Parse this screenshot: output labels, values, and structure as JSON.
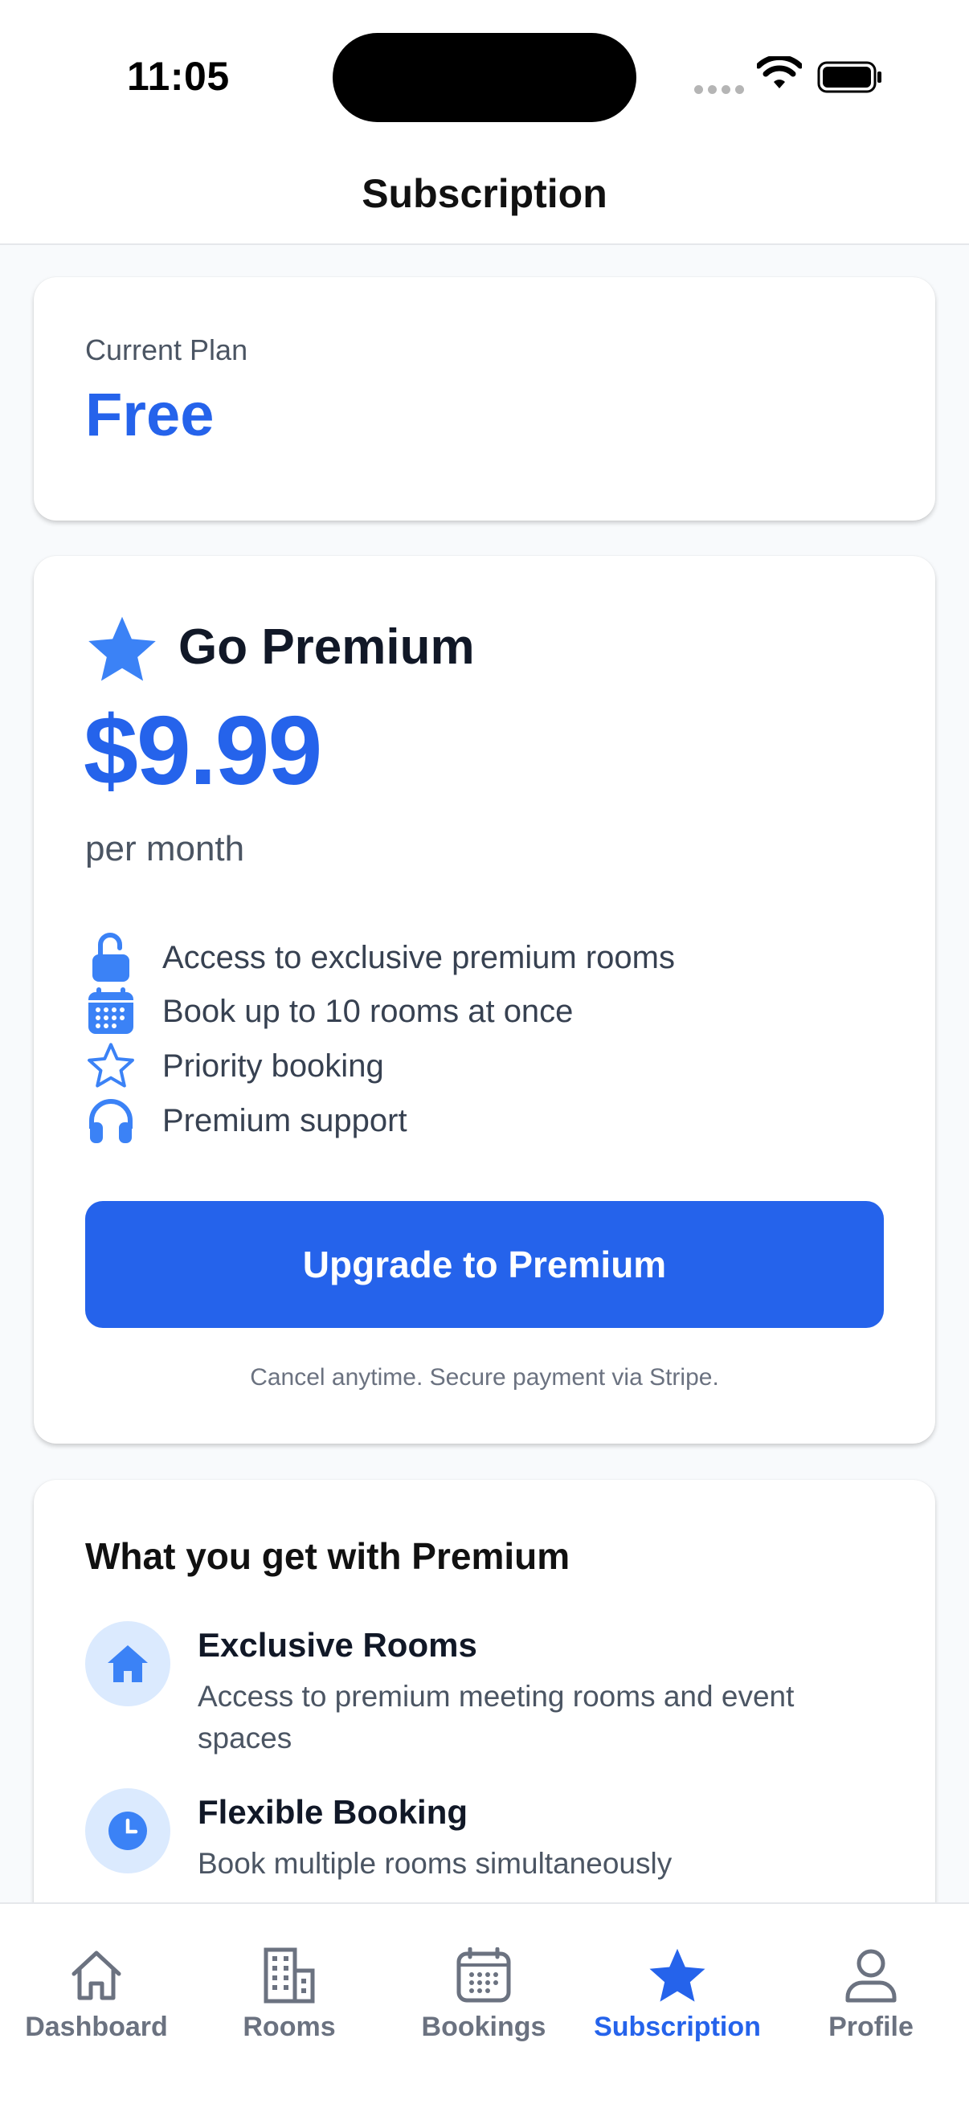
{
  "status_bar": {
    "time": "11:05"
  },
  "header": {
    "title": "Subscription"
  },
  "current_plan": {
    "label": "Current Plan",
    "value": "Free"
  },
  "premium": {
    "title": "Go Premium",
    "price": "$9.99",
    "period": "per month",
    "features": [
      {
        "icon": "lock-open-icon",
        "text": "Access to exclusive premium rooms"
      },
      {
        "icon": "calendar-icon",
        "text": "Book up to 10 rooms at once"
      },
      {
        "icon": "star-outline-icon",
        "text": "Priority booking"
      },
      {
        "icon": "headphones-icon",
        "text": "Premium support"
      }
    ],
    "button_label": "Upgrade to Premium",
    "fine_print": "Cancel anytime. Secure payment via Stripe."
  },
  "benefits": {
    "title": "What you get with Premium",
    "items": [
      {
        "icon": "home-icon",
        "title": "Exclusive Rooms",
        "description": "Access to premium meeting rooms and event spaces"
      },
      {
        "icon": "clock-icon",
        "title": "Flexible Booking",
        "description": "Book multiple rooms simultaneously"
      }
    ]
  },
  "tabs": [
    {
      "label": "Dashboard",
      "icon": "home-icon",
      "active": false
    },
    {
      "label": "Rooms",
      "icon": "building-icon",
      "active": false
    },
    {
      "label": "Bookings",
      "icon": "calendar-icon",
      "active": false
    },
    {
      "label": "Subscription",
      "icon": "star-icon",
      "active": true
    },
    {
      "label": "Profile",
      "icon": "person-icon",
      "active": false
    }
  ],
  "colors": {
    "accent": "#2563eb",
    "accent_light": "#dbeafe",
    "muted": "#6b7280"
  }
}
